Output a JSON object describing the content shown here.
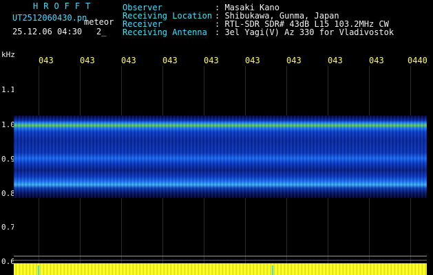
{
  "header": {
    "brand": "HROFFT",
    "filename": "UT2512060430.pn",
    "meteor_label": "meteor",
    "datetime": "25.12.06 04:30",
    "counter": "2_",
    "info": [
      {
        "label": "Observer",
        "value": ": Masaki Kano"
      },
      {
        "label": "Receiving Location",
        "value": ": Shibukawa, Gunma, Japan"
      },
      {
        "label": "Receiver",
        "value": ": RTL-SDR SDR# 43dB L15 103.2MHz CW"
      },
      {
        "label": "Receiving Antenna",
        "value": ": 3el Yagi(V) Az 330 for Vladivostok"
      }
    ]
  },
  "axis": {
    "y_unit": "kHz",
    "y_ticks": [
      "1.1",
      "1.0",
      "0.9",
      "0.8",
      "0.7",
      "0.6"
    ],
    "x_ticks": [
      "043",
      "043",
      "043",
      "043",
      "043",
      "043",
      "043",
      "043",
      "043",
      "0440"
    ]
  },
  "colors": {
    "label_cyan": "#3fe0ff",
    "value_yellow": "#ffff3a",
    "strip_yellow": "#ffff30"
  }
}
